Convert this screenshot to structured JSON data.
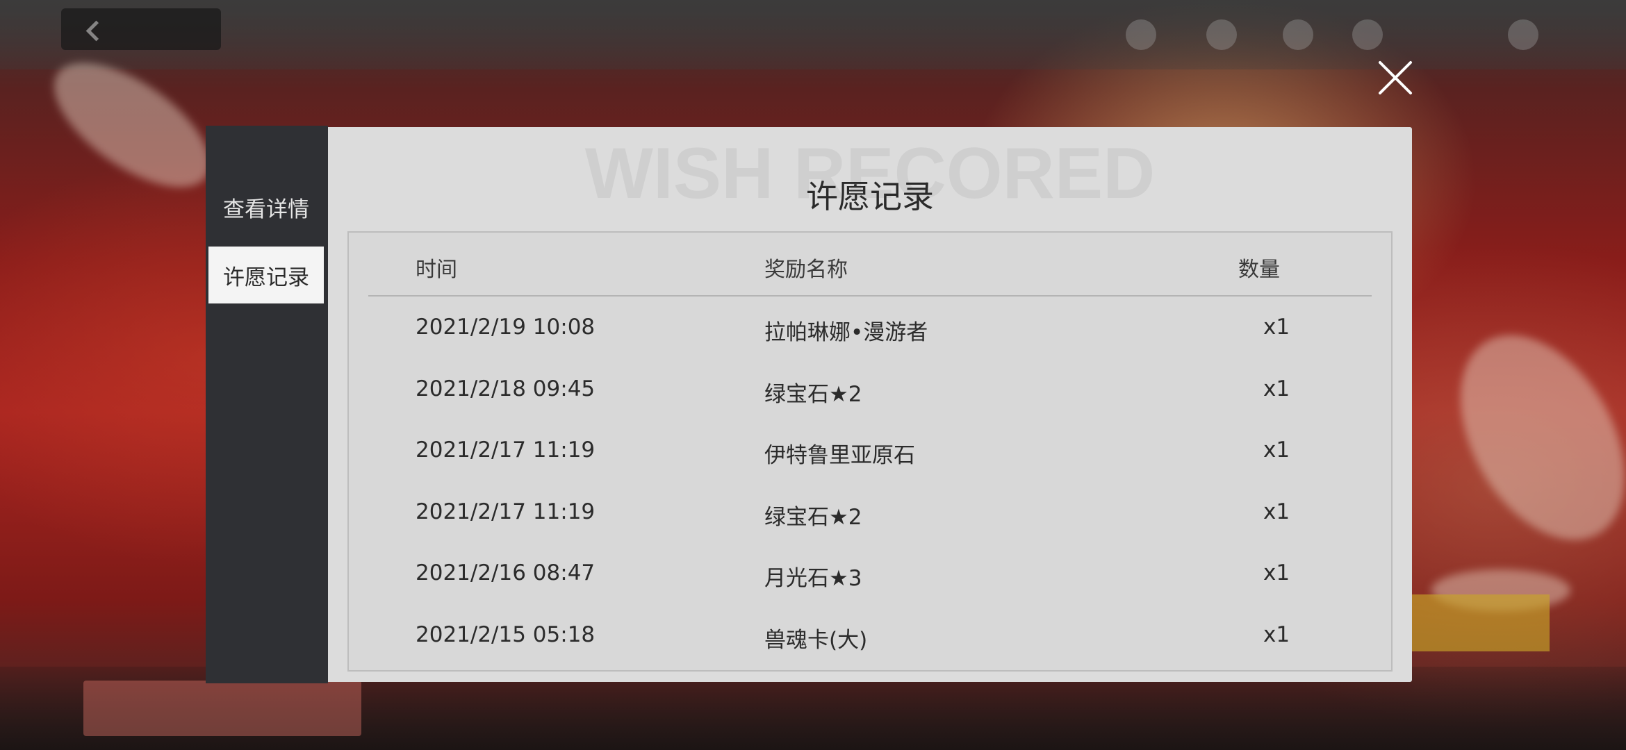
{
  "sidebar": {
    "items": [
      {
        "label": "查看详情",
        "active": false
      },
      {
        "label": "许愿记录",
        "active": true
      }
    ]
  },
  "modal": {
    "watermark": "WISH RECORED",
    "title": "许愿记录",
    "columns": {
      "time": "时间",
      "reward": "奖励名称",
      "quantity": "数量"
    },
    "rows": [
      {
        "time": "2021/2/19 10:08",
        "reward": "拉帕琳娜•漫游者",
        "quantity": "x1"
      },
      {
        "time": "2021/2/18 09:45",
        "reward": "绿宝石★2",
        "quantity": "x1"
      },
      {
        "time": "2021/2/17 11:19",
        "reward": "伊特鲁里亚原石",
        "quantity": "x1"
      },
      {
        "time": "2021/2/17 11:19",
        "reward": "绿宝石★2",
        "quantity": "x1"
      },
      {
        "time": "2021/2/16 08:47",
        "reward": "月光石★3",
        "quantity": "x1"
      },
      {
        "time": "2021/2/15 05:18",
        "reward": "兽魂卡(大)",
        "quantity": "x1"
      }
    ]
  },
  "icons": {
    "close": "close-icon"
  },
  "colors": {
    "sidebar_bg": "#2f3034",
    "panel_bg": "#dcdcdc",
    "active_tab_bg": "#f4f4f4"
  }
}
